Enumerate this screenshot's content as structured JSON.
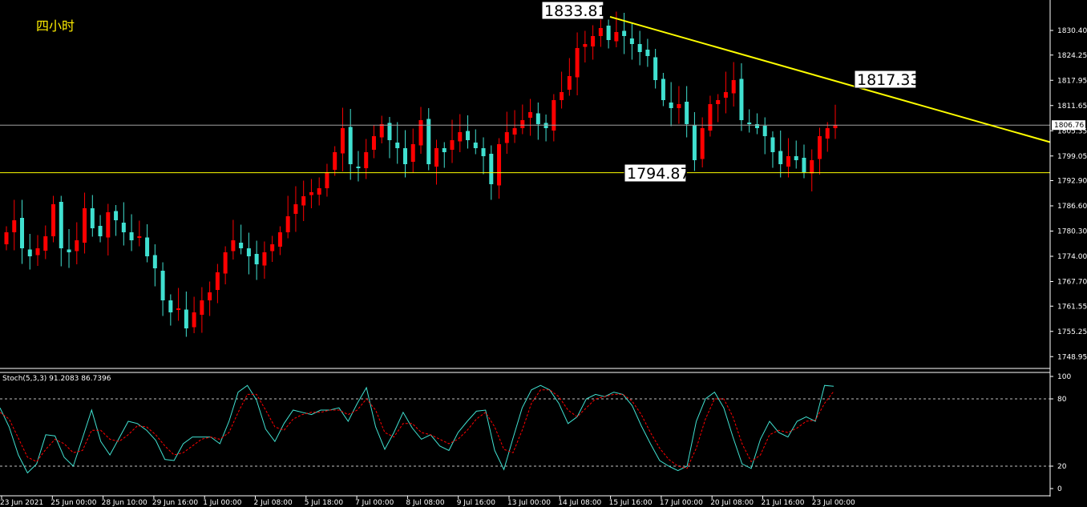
{
  "period_label": "四小时",
  "indicator_label": "Stoch(5,3,3) 91.2083 86.7396",
  "colors": {
    "background": "#000000",
    "bull": "#ff0000",
    "bear": "#40e0d0",
    "trendline": "#ffff00",
    "support": "#ffff00",
    "current_price_line": "#a0a0a0",
    "stoch_main": "#40e0d0",
    "stoch_signal": "#ff0000",
    "level_line": "#c0c0c0"
  },
  "chart_data": [
    {
      "type": "candlestick",
      "ylim": [
        1746,
        1838
      ],
      "y_ticks": [
        "1830.40",
        "1824.25",
        "1817.95",
        "1811.65",
        "1805.35",
        "1799.05",
        "1792.90",
        "1786.60",
        "1780.30",
        "1774.00",
        "1767.70",
        "1761.55",
        "1755.25",
        "1748.95"
      ],
      "current_price": "1806.76",
      "x_ticks": [
        "23 Jun 2021",
        "25 Jun 00:00",
        "28 Jun 10:00",
        "29 Jun 16:00",
        "1 Jul 00:00",
        "2 Jul 08:00",
        "5 Jul 18:00",
        "7 Jul 00:00",
        "8 Jul 08:00",
        "9 Jul 16:00",
        "13 Jul 00:00",
        "14 Jul 08:00",
        "15 Jul 16:00",
        "17 Jul 00:00",
        "20 Jul 08:00",
        "21 Jul 16:00",
        "23 Jul 00:00"
      ],
      "annotations": {
        "high": "1833.81",
        "trendline_value": "1817.33",
        "support": "1794.87"
      },
      "support_level": 1794.87,
      "trendline": [
        [
          0.5,
          1833.81
        ],
        [
          1.0,
          1802.5
        ]
      ],
      "close_sequence": [
        1780,
        1783,
        1776,
        1774,
        1776,
        1779,
        1787,
        1776,
        1775,
        1778,
        1786,
        1781,
        1779,
        1785,
        1783,
        1780,
        1778,
        1779,
        1774,
        1771,
        1763,
        1760,
        1761,
        1756,
        1760,
        1763,
        1765,
        1770,
        1775,
        1778,
        1776,
        1774,
        1772,
        1775,
        1777,
        1780,
        1784,
        1787,
        1789,
        1790,
        1791,
        1795,
        1800,
        1806,
        1797,
        1796,
        1800,
        1804,
        1807,
        1803,
        1801,
        1797,
        1802,
        1808,
        1797,
        1801,
        1800,
        1803,
        1805,
        1803,
        1801,
        1799,
        1792,
        1802,
        1805,
        1806,
        1808,
        1810,
        1807,
        1806,
        1813,
        1815,
        1819,
        1826,
        1827,
        1829,
        1831,
        1828,
        1830,
        1829,
        1827,
        1825,
        1824,
        1818,
        1813,
        1811,
        1812,
        1807,
        1798,
        1806,
        1812,
        1813,
        1815,
        1818,
        1808,
        1807,
        1806,
        1804,
        1800,
        1797,
        1799,
        1798,
        1795,
        1798,
        1804,
        1806,
        1806.76
      ]
    },
    {
      "type": "line",
      "title": "Stoch(5,3,3) 91.2083 86.7396",
      "ylim": [
        0,
        100
      ],
      "y_ticks": [
        "100",
        "80",
        "20",
        "0"
      ],
      "levels": [
        80,
        20
      ],
      "series": [
        {
          "name": "Main",
          "values": [
            72,
            55,
            30,
            14,
            22,
            48,
            47,
            28,
            20,
            45,
            70,
            42,
            30,
            45,
            60,
            58,
            52,
            43,
            26,
            25,
            40,
            46,
            46,
            46,
            40,
            60,
            86,
            92,
            79,
            53,
            42,
            58,
            70,
            68,
            66,
            70,
            70,
            72,
            60,
            76,
            90,
            55,
            35,
            50,
            68,
            54,
            44,
            48,
            38,
            34,
            50,
            60,
            69,
            70,
            34,
            17,
            45,
            72,
            88,
            92,
            88,
            76,
            58,
            64,
            80,
            84,
            82,
            86,
            84,
            74,
            56,
            40,
            25,
            20,
            16,
            20,
            60,
            80,
            86,
            72,
            46,
            22,
            18,
            44,
            60,
            50,
            46,
            60,
            64,
            60,
            92,
            91.2083
          ]
        },
        {
          "name": "Signal",
          "values": [
            68,
            62,
            45,
            28,
            24,
            35,
            44,
            40,
            32,
            34,
            52,
            52,
            44,
            42,
            48,
            56,
            55,
            48,
            38,
            30,
            32,
            38,
            44,
            46,
            44,
            50,
            68,
            84,
            84,
            70,
            55,
            52,
            62,
            66,
            68,
            68,
            70,
            70,
            66,
            70,
            80,
            70,
            50,
            46,
            58,
            58,
            50,
            48,
            44,
            40,
            44,
            52,
            62,
            68,
            55,
            35,
            32,
            52,
            76,
            88,
            88,
            82,
            70,
            64,
            72,
            80,
            82,
            84,
            84,
            78,
            66,
            50,
            36,
            26,
            20,
            18,
            36,
            62,
            80,
            80,
            64,
            40,
            24,
            30,
            48,
            52,
            50,
            54,
            60,
            61,
            76,
            86.7396
          ]
        }
      ]
    }
  ]
}
